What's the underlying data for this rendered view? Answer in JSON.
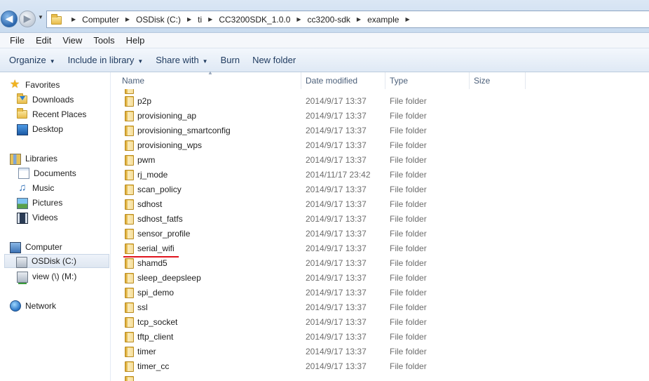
{
  "address": {
    "breadcrumbs": [
      "Computer",
      "OSDisk (C:)",
      "ti",
      "CC3200SDK_1.0.0",
      "cc3200-sdk",
      "example"
    ]
  },
  "menu": [
    "File",
    "Edit",
    "View",
    "Tools",
    "Help"
  ],
  "commands": {
    "organize": "Organize",
    "include": "Include in library",
    "share": "Share with",
    "burn": "Burn",
    "new_folder": "New folder"
  },
  "nav": {
    "favorites": "Favorites",
    "downloads": "Downloads",
    "recent": "Recent Places",
    "desktop": "Desktop",
    "libraries": "Libraries",
    "documents": "Documents",
    "music": "Music",
    "pictures": "Pictures",
    "videos": "Videos",
    "computer": "Computer",
    "osdisk": "OSDisk (C:)",
    "view": "view (\\) (M:)",
    "network": "Network"
  },
  "columns": {
    "name": "Name",
    "date": "Date modified",
    "type": "Type",
    "size": "Size"
  },
  "files": [
    {
      "name": "p2p",
      "date": "2014/9/17 13:37",
      "type": "File folder"
    },
    {
      "name": "provisioning_ap",
      "date": "2014/9/17 13:37",
      "type": "File folder"
    },
    {
      "name": "provisioning_smartconfig",
      "date": "2014/9/17 13:37",
      "type": "File folder"
    },
    {
      "name": "provisioning_wps",
      "date": "2014/9/17 13:37",
      "type": "File folder"
    },
    {
      "name": "pwm",
      "date": "2014/9/17 13:37",
      "type": "File folder"
    },
    {
      "name": "rj_mode",
      "date": "2014/11/17 23:42",
      "type": "File folder"
    },
    {
      "name": "scan_policy",
      "date": "2014/9/17 13:37",
      "type": "File folder"
    },
    {
      "name": "sdhost",
      "date": "2014/9/17 13:37",
      "type": "File folder"
    },
    {
      "name": "sdhost_fatfs",
      "date": "2014/9/17 13:37",
      "type": "File folder"
    },
    {
      "name": "sensor_profile",
      "date": "2014/9/17 13:37",
      "type": "File folder"
    },
    {
      "name": "serial_wifi",
      "date": "2014/9/17 13:37",
      "type": "File folder"
    },
    {
      "name": "shamd5",
      "date": "2014/9/17 13:37",
      "type": "File folder"
    },
    {
      "name": "sleep_deepsleep",
      "date": "2014/9/17 13:37",
      "type": "File folder"
    },
    {
      "name": "spi_demo",
      "date": "2014/9/17 13:37",
      "type": "File folder"
    },
    {
      "name": "ssl",
      "date": "2014/9/17 13:37",
      "type": "File folder"
    },
    {
      "name": "tcp_socket",
      "date": "2014/9/17 13:37",
      "type": "File folder"
    },
    {
      "name": "tftp_client",
      "date": "2014/9/17 13:37",
      "type": "File folder"
    },
    {
      "name": "timer",
      "date": "2014/9/17 13:37",
      "type": "File folder"
    },
    {
      "name": "timer_cc",
      "date": "2014/9/17 13:37",
      "type": "File folder"
    }
  ]
}
